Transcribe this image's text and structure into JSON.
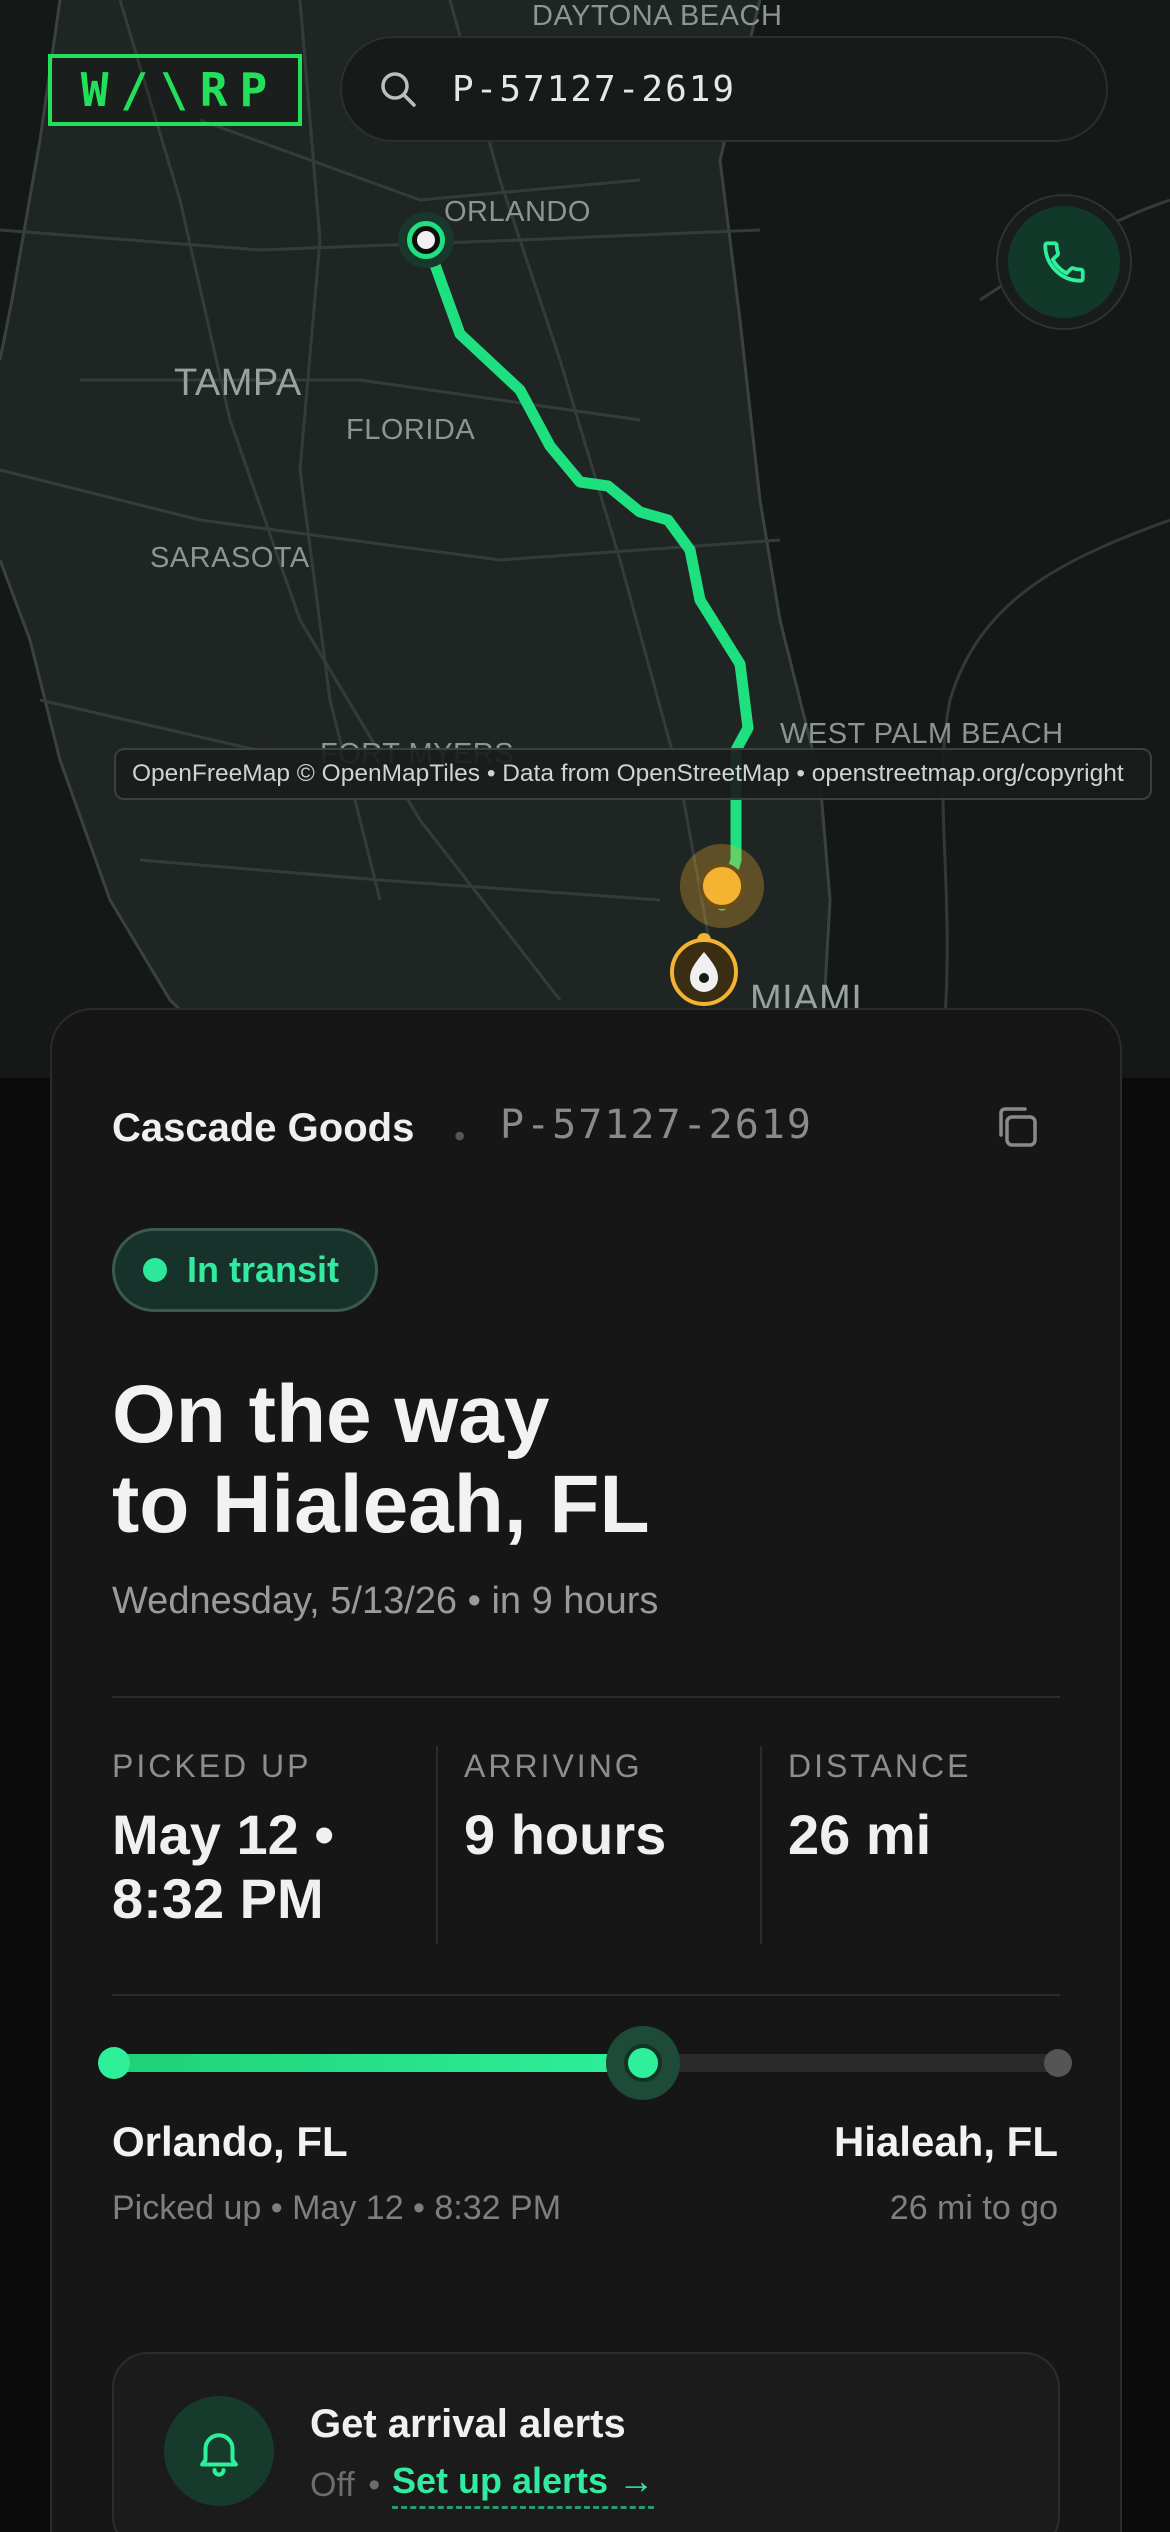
{
  "app": {
    "brand": "W/\\RP",
    "brand_color": "#22e05a",
    "accent_color": "#2ef09a"
  },
  "search": {
    "value": "P-57127-2619",
    "icon": "search-icon"
  },
  "call_button": {
    "icon": "phone-icon"
  },
  "map": {
    "labels": {
      "daytona": "DAYTONA BEACH",
      "orlando": "ORLANDO",
      "tampa": "TAMPA",
      "florida": "FLORIDA",
      "sarasota": "SARASOTA",
      "fort_myers": "FORT MYERS",
      "west_palm": "WEST PALM BEACH",
      "miami": "MIAMI"
    },
    "attribution": "OpenFreeMap © OpenMapTiles • Data from OpenStreetMap • openstreetmap.org/copyright",
    "route_color": "#1fe07e",
    "current_marker_color": "#f5b332"
  },
  "shipment": {
    "merchant": "Cascade Goods",
    "separator": "•",
    "id": "P-57127-2619",
    "status": "In transit",
    "headline_line1": "On the way",
    "headline_line2": "to Hialeah, FL",
    "eta": "Wednesday, 5/13/26 • in 9 hours",
    "stats": {
      "picked_up_label": "PICKED UP",
      "picked_up_line1": "May 12 •",
      "picked_up_line2": "8:32 PM",
      "arriving_label": "ARRIVING",
      "arriving_value": "9 hours",
      "distance_label": "DISTANCE",
      "distance_value": "26 mi"
    },
    "progress": {
      "fraction": 0.56,
      "origin_city": "Orlando, FL",
      "origin_sub": "Picked up • May 12 • 8:32 PM",
      "dest_city": "Hialeah, FL",
      "dest_sub": "26 mi to go"
    }
  },
  "alerts": {
    "title": "Get arrival alerts",
    "status": "Off",
    "separator": "•",
    "link": "Set up alerts →",
    "icon": "bell-icon"
  }
}
